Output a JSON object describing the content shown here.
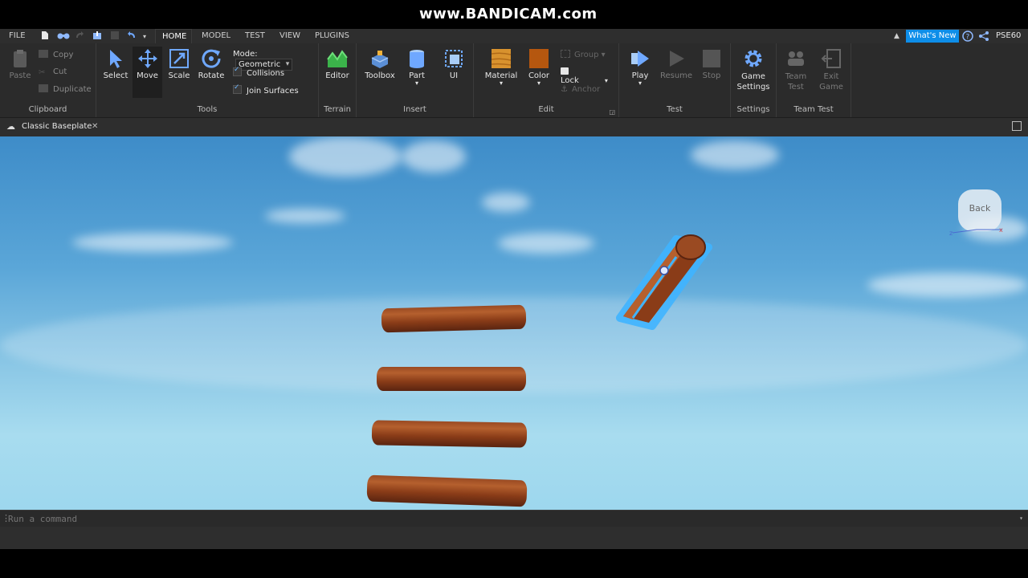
{
  "watermark": "www.BANDICAM.com",
  "menu": {
    "file": "FILE",
    "tabs": [
      "HOME",
      "MODEL",
      "TEST",
      "VIEW",
      "PLUGINS"
    ],
    "whats_new": "What's New",
    "user": "PSE60"
  },
  "ribbon": {
    "clipboard": {
      "label": "Clipboard",
      "paste": "Paste",
      "copy": "Copy",
      "cut": "Cut",
      "duplicate": "Duplicate"
    },
    "tools": {
      "label": "Tools",
      "select": "Select",
      "move": "Move",
      "scale": "Scale",
      "rotate": "Rotate",
      "mode_label": "Mode:",
      "mode_value": "Geometric",
      "collisions": "Collisions",
      "join_surfaces": "Join Surfaces"
    },
    "terrain": {
      "label": "Terrain",
      "editor": "Editor"
    },
    "insert": {
      "label": "Insert",
      "toolbox": "Toolbox",
      "part": "Part",
      "ui": "UI"
    },
    "edit": {
      "label": "Edit",
      "material": "Material",
      "color": "Color",
      "group": "Group",
      "lock": "Lock",
      "anchor": "Anchor"
    },
    "test": {
      "label": "Test",
      "play": "Play",
      "resume": "Resume",
      "stop": "Stop"
    },
    "settings": {
      "label": "Settings",
      "game_settings_1": "Game",
      "game_settings_2": "Settings"
    },
    "team_test": {
      "label": "Team Test",
      "team_test_1": "Team",
      "team_test_2": "Test",
      "exit_game_1": "Exit",
      "exit_game_2": "Game"
    }
  },
  "document_tab": "Classic Baseplate",
  "viewport": {
    "back_label": "Back"
  },
  "command": {
    "placeholder": "Run a command"
  },
  "colors": {
    "accent": "#0e8ee9",
    "log": "#8a3c18",
    "selection": "#3fb4ff"
  }
}
